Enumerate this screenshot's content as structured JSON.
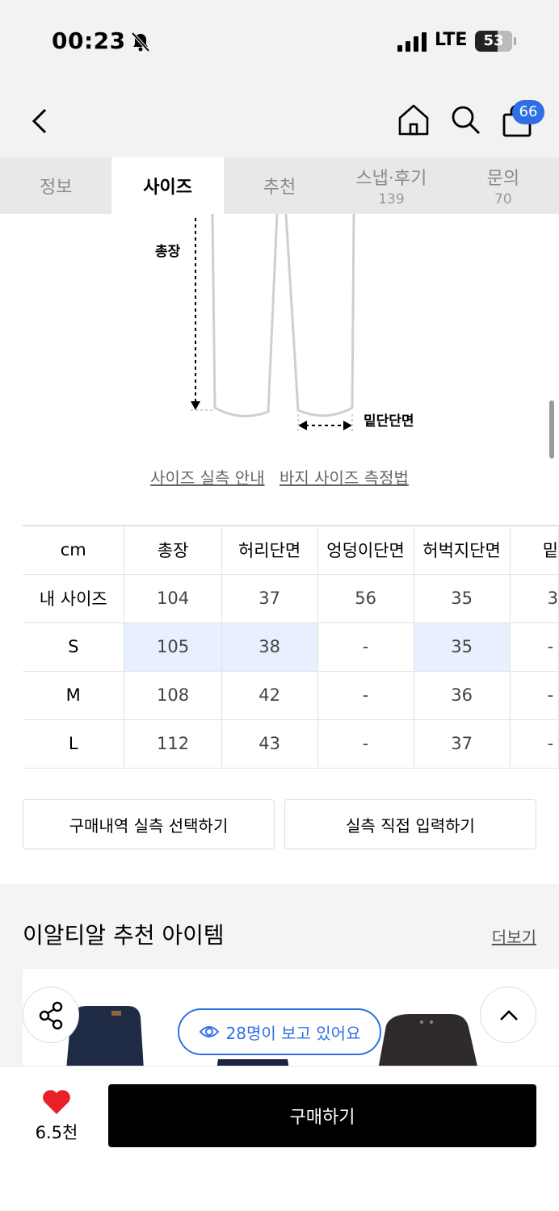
{
  "status": {
    "time": "00:23",
    "network": "LTE",
    "battery": "53"
  },
  "header": {
    "cart_count": "66"
  },
  "tabs": [
    {
      "label": "정보",
      "count": ""
    },
    {
      "label": "사이즈",
      "count": ""
    },
    {
      "label": "추천",
      "count": ""
    },
    {
      "label": "스냅·후기",
      "count": "139"
    },
    {
      "label": "문의",
      "count": "70"
    }
  ],
  "diagram": {
    "length_label": "총장",
    "hem_label": "밑단단면"
  },
  "size_links": {
    "actual_guide": "사이즈 실측 안내",
    "measure_guide": "바지 사이즈 측정법"
  },
  "size_table": {
    "headers": [
      "cm",
      "총장",
      "허리단면",
      "엉덩이단면",
      "허벅지단면",
      "밑"
    ],
    "rows": [
      {
        "label": "내 사이즈",
        "values": [
          "104",
          "37",
          "56",
          "35",
          "3"
        ]
      },
      {
        "label": "S",
        "values": [
          "105",
          "38",
          "-",
          "35",
          "-"
        ]
      },
      {
        "label": "M",
        "values": [
          "108",
          "42",
          "-",
          "36",
          "-"
        ]
      },
      {
        "label": "L",
        "values": [
          "112",
          "43",
          "-",
          "37",
          "-"
        ]
      }
    ]
  },
  "actions": {
    "select_purchase": "구매내역 실측 선택하기",
    "direct_input": "실측 직접 입력하기"
  },
  "recommend": {
    "title": "이알티알 추천 아이템",
    "more": "더보기"
  },
  "viewers": {
    "text": "28명이 보고 있어요"
  },
  "bottom": {
    "like_count": "6.5천",
    "buy_label": "구매하기"
  },
  "colors": {
    "accent": "#2f6fe4",
    "highlight": "#e8efff",
    "heart": "#e8202a"
  }
}
